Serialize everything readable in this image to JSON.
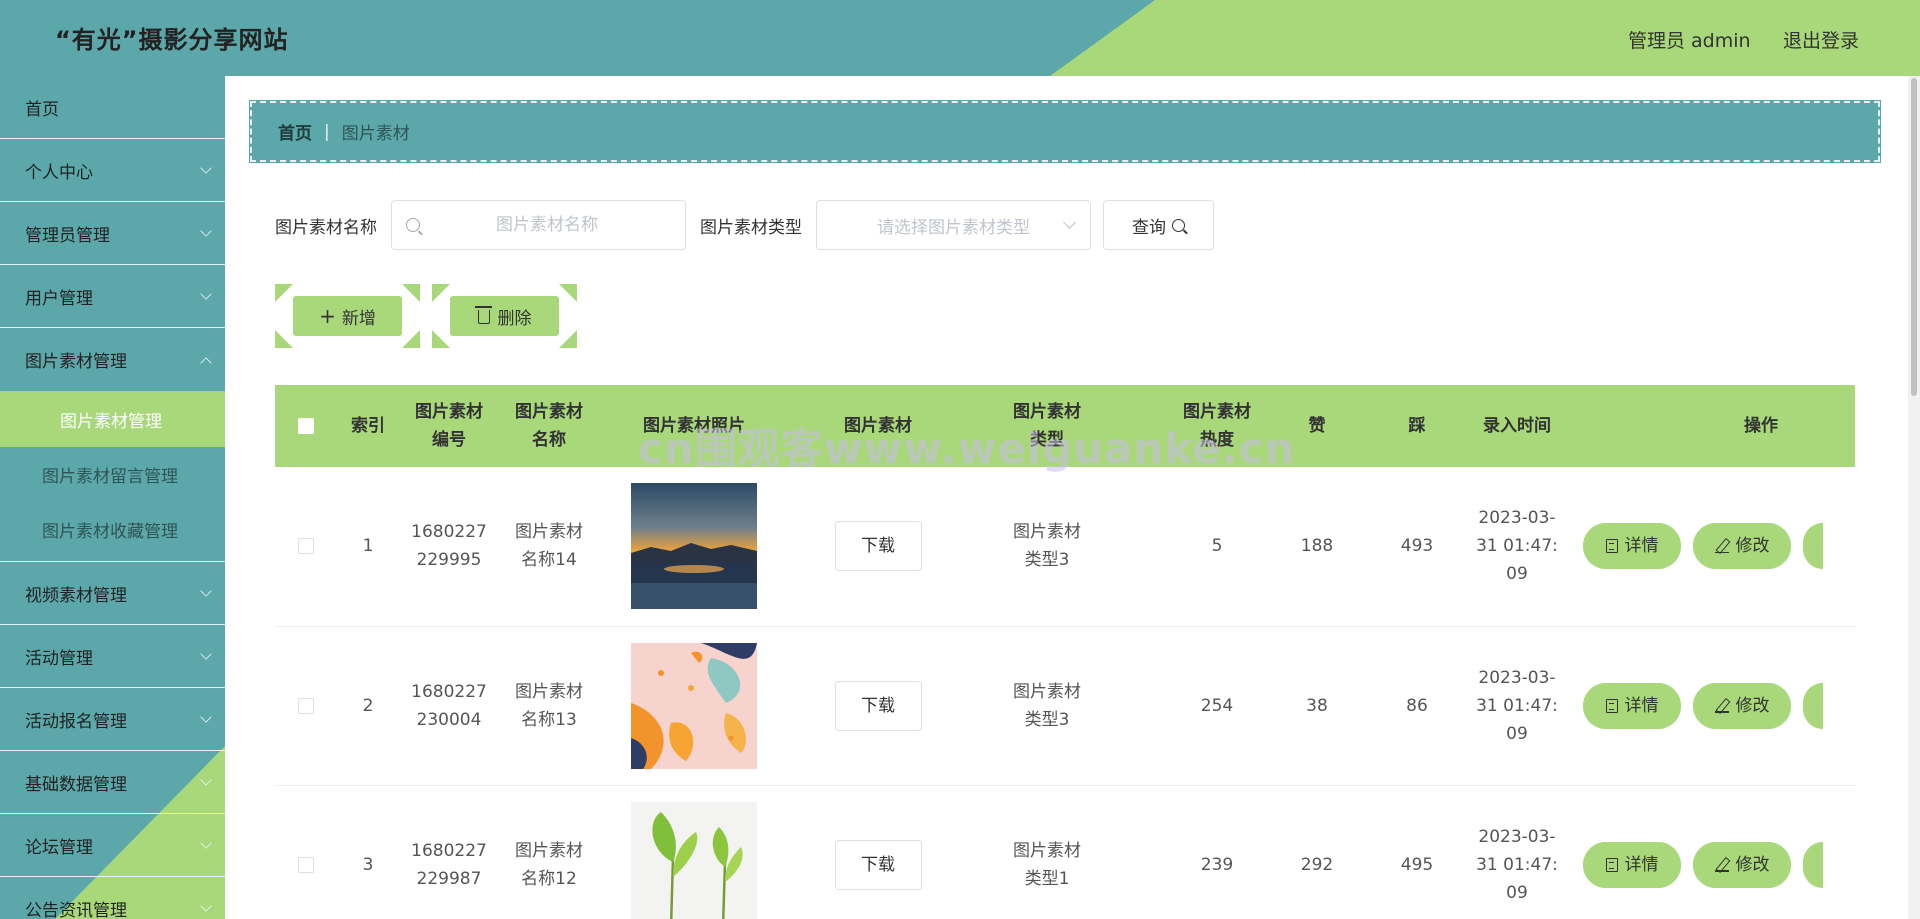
{
  "header": {
    "title": "“有光”摄影分享网站",
    "admin_label": "管理员 admin",
    "logout_label": "退出登录",
    "colors": {
      "teal": "#5ba7a9",
      "green": "#a8d87a"
    }
  },
  "sidebar": {
    "items": [
      {
        "label": "首页"
      },
      {
        "label": "个人中心"
      },
      {
        "label": "管理员管理"
      },
      {
        "label": "用户管理"
      },
      {
        "label": "图片素材管理"
      },
      {
        "label": "视频素材管理"
      },
      {
        "label": "活动管理"
      },
      {
        "label": "活动报名管理"
      },
      {
        "label": "基础数据管理"
      },
      {
        "label": "论坛管理"
      },
      {
        "label": "公告资讯管理"
      }
    ],
    "sub_items": [
      {
        "label": "图片素材管理",
        "active": true
      },
      {
        "label": "图片素材留言管理"
      },
      {
        "label": "图片素材收藏管理"
      }
    ]
  },
  "breadcrumb": {
    "home": "首页",
    "separator": "|",
    "current": "图片素材"
  },
  "search": {
    "name_label": "图片素材名称",
    "name_placeholder": "图片素材名称",
    "type_label": "图片素材类型",
    "type_placeholder": "请选择图片素材类型",
    "query_label": "查询"
  },
  "actions": {
    "add_label": "新增",
    "delete_label": "删除"
  },
  "table": {
    "headers": [
      "索引",
      "图片素材编号",
      "图片素材名称",
      "图片素材照片",
      "图片素材",
      "图片素材类型",
      "图片素材热度",
      "赞",
      "踩",
      "录入时间",
      "操作"
    ],
    "header_lines": {
      "h1": [
        "图片素材",
        "编号"
      ],
      "h2": [
        "图片素材",
        "名称"
      ],
      "h3": [
        "图片素材照片"
      ],
      "h5": [
        "图片素材",
        "类型"
      ],
      "h6": [
        "图片素材",
        "热度"
      ]
    },
    "download_label": "下载",
    "detail_label": "详情",
    "edit_label": "修改",
    "rows": [
      {
        "index": "1",
        "code": [
          "1680227",
          "229995"
        ],
        "name": [
          "图片素材",
          "名称14"
        ],
        "photo": "sunset-lake",
        "type": [
          "图片素材",
          "类型3"
        ],
        "heat": "5",
        "like": "188",
        "dislike": "493",
        "time": [
          "2023-03-",
          "31 01:47:",
          "09"
        ]
      },
      {
        "index": "2",
        "code": [
          "1680227",
          "230004"
        ],
        "name": [
          "图片素材",
          "名称13"
        ],
        "photo": "autumn-leaves",
        "type": [
          "图片素材",
          "类型3"
        ],
        "heat": "254",
        "like": "38",
        "dislike": "86",
        "time": [
          "2023-03-",
          "31 01:47:",
          "09"
        ]
      },
      {
        "index": "3",
        "code": [
          "1680227",
          "229987"
        ],
        "name": [
          "图片素材",
          "名称12"
        ],
        "photo": "green-sprouts",
        "type": [
          "图片素材",
          "类型1"
        ],
        "heat": "239",
        "like": "292",
        "dislike": "495",
        "time": [
          "2023-03-",
          "31 01:47:",
          "09"
        ]
      }
    ]
  },
  "watermark": "cn围观客www.weiguanke.cn"
}
